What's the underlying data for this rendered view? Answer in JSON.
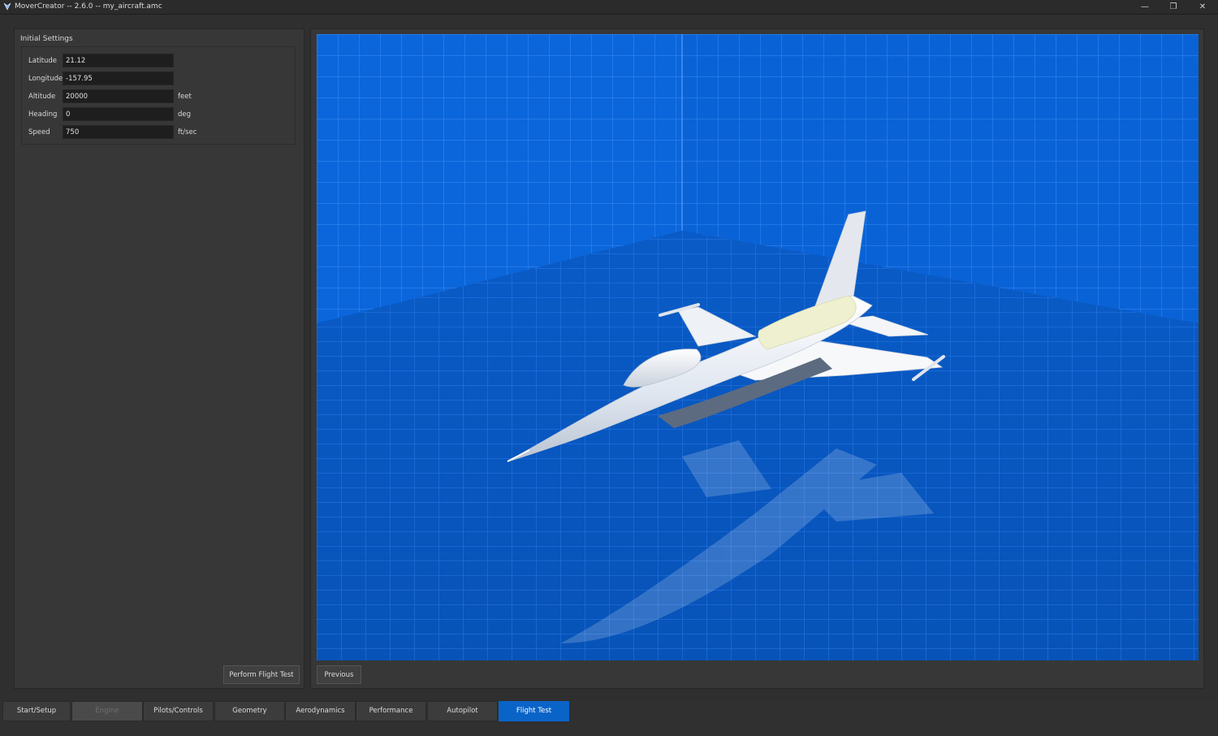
{
  "window": {
    "title": "MoverCreator -- 2.6.0 -- my_aircraft.amc",
    "minimize_glyph": "—",
    "restore_glyph": "❐",
    "close_glyph": "✕"
  },
  "initial_settings": {
    "title": "Initial Settings",
    "fields": [
      {
        "label": "Latitude",
        "value": "21.12",
        "unit": ""
      },
      {
        "label": "Longitude",
        "value": "-157.95",
        "unit": ""
      },
      {
        "label": "Altitude",
        "value": "20000",
        "unit": "feet"
      },
      {
        "label": "Heading",
        "value": "0",
        "unit": "deg"
      },
      {
        "label": "Speed",
        "value": "750",
        "unit": "ft/sec"
      }
    ]
  },
  "buttons": {
    "perform_flight_test": "Perform Flight Test",
    "previous": "Previous"
  },
  "tabs": [
    {
      "label": "Start/Setup",
      "state": "normal"
    },
    {
      "label": "Engine",
      "state": "disabled"
    },
    {
      "label": "Pilots/Controls",
      "state": "normal"
    },
    {
      "label": "Geometry",
      "state": "normal"
    },
    {
      "label": "Aerodynamics",
      "state": "normal"
    },
    {
      "label": "Performance",
      "state": "normal"
    },
    {
      "label": "Autopilot",
      "state": "normal"
    },
    {
      "label": "Flight Test",
      "state": "active"
    }
  ],
  "colors": {
    "accent": "#0a64c8",
    "viewport_background": "#0a5fd0",
    "grid_line": "#3f8cf5"
  },
  "icons": {
    "app": "movercreator-logo-icon"
  }
}
